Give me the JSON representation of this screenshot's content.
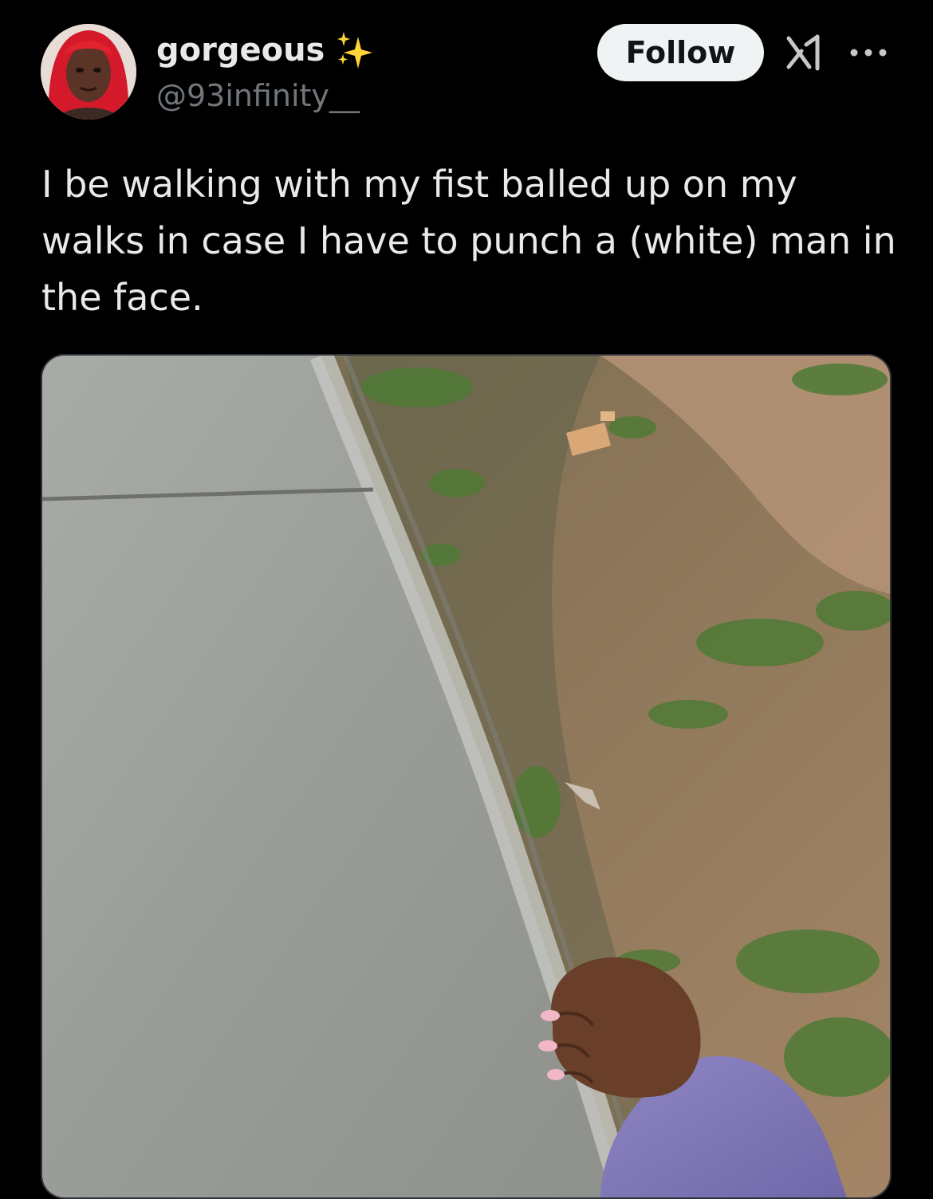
{
  "author": {
    "display_name": "gorgeous",
    "handle": "@93infinity__",
    "avatar_icon": "profile-photo",
    "badge_icon": "sparkles-icon"
  },
  "actions": {
    "follow_label": "Follow",
    "grok_icon": "grok-icon",
    "more_icon": "more-icon"
  },
  "post": {
    "text": "I be walking with my fist balled up on my walks in case I have to punch a (white) man in the face.",
    "media_description_icon": "photo"
  },
  "colors": {
    "background": "#000000",
    "text_primary": "#e7e9ea",
    "text_secondary": "#71767b",
    "follow_button_bg": "#eff3f4",
    "follow_button_text": "#0f1419",
    "sparkle": "#ffd43b"
  }
}
